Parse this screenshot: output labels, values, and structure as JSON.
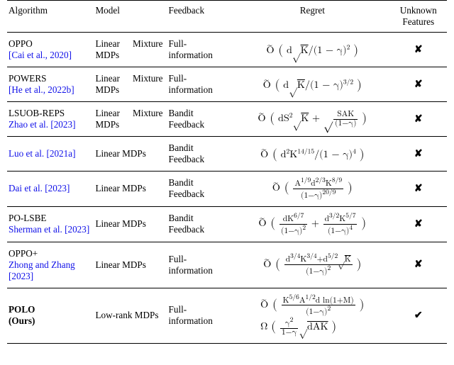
{
  "headers": {
    "algo": "Algorithm",
    "model": "Model",
    "feedback": "Feedback",
    "regret": "Regret",
    "unknown": "Unknown Features"
  },
  "rows": [
    {
      "algo_name": "OPPO",
      "cite": "[Cai et al., 2020]",
      "model": "Linear Mixture MDPs",
      "feedback": "Full-information",
      "regret_html": "<span class='tilde-o'>O</span> <span class='big'>(</span> d<span style='font-size:14px'>√</span><span class='sqrt'>K</span>/(1 − γ)<sup>2</sup> <span class='big'>)</span>",
      "unknown": false
    },
    {
      "algo_name": "POWERS",
      "cite": "[He et al., 2022b]",
      "model": "Linear Mixture MDPs",
      "feedback": "Full-information",
      "regret_html": "<span class='tilde-o'>O</span> <span class='big'>(</span> d<span style='font-size:14px'>√</span><span class='sqrt'>K</span>/(1 − γ)<sup>3/2</sup> <span class='big'>)</span>",
      "unknown": false
    },
    {
      "algo_name": "LSUOB-REPS",
      "cite": "Zhao et al. [2023]",
      "model": "Linear Mixture MDPs",
      "feedback": "Bandit Feedback",
      "regret_html": "<span class='tilde-o'>O</span> <span class='big'>(</span> dS<sup>2</sup><span style='font-size:14px'>√</span><span class='sqrt'>K</span> + <span style='font-size:16px;position:relative;top:1px'>√</span><span class='sqrt'><span class='frac'><span class='num'>SAK</span><span class='den'>(1−γ)</span></span></span> <span class='big'>)</span>",
      "unknown": false
    },
    {
      "algo_name": "",
      "cite": "Luo et al. [2021a]",
      "model": "Linear MDPs",
      "feedback": "Bandit Feedback",
      "regret_html": "<span class='tilde-o'>O</span> <span class='big'>(</span> d<sup>2</sup>K<sup>14/15</sup>/(1 − γ)<sup>4</sup> <span class='big'>)</span>",
      "unknown": false
    },
    {
      "algo_name": "",
      "cite": "Dai et al. [2023]",
      "model": "Linear MDPs",
      "feedback": "Bandit Feedback",
      "regret_html": "<span class='tilde-o'>O</span> <span class='big'>(</span> <span class='frac'><span class='num'>A<sup>1/9</sup>d<sup>2/3</sup>K<sup>8/9</sup></span><span class='den'>(1−γ)<sup>20/9</sup></span></span> <span class='big'>)</span>",
      "unknown": false
    },
    {
      "algo_name": "PO-LSBE",
      "cite": "Sherman et al. [2023]",
      "model": "Linear MDPs",
      "feedback": "Bandit Feedback",
      "regret_html": "<span class='tilde-o'>O</span> <span class='big'>(</span> <span class='frac'><span class='num'>dK<sup>6/7</sup></span><span class='den'>(1−γ)<sup>2</sup></span></span> + <span class='frac'><span class='num'>d<sup>3/2</sup>K<sup>5/7</sup></span><span class='den'>(1−γ)<sup>4</sup></span></span> <span class='big'>)</span>",
      "unknown": false
    },
    {
      "algo_name": "OPPO+",
      "cite": "Zhong and Zhang [2023]",
      "model": "Linear MDPs",
      "feedback": "Full-information",
      "regret_html": "<span class='tilde-o'>O</span> <span class='big'>(</span> <span class='frac'><span class='num'>d<sup>3/4</sup>K<sup>3/4</sup>+d<sup>5/2</sup>√<span class='sqrt'>K</span></span><span class='den'>(1−γ)<sup>2</sup></span></span> <span class='big'>)</span>",
      "unknown": false
    },
    {
      "algo_name": "POLO",
      "ours_label": "(Ours)",
      "cite": "",
      "model": "Low-rank MDPs",
      "feedback": "Full-information",
      "regret_html": "<span class='stack'><span class='line'><span class='tilde-o'>O</span> <span class='big'>(</span> <span class='frac'><span class='num'>K<sup>5/6</sup>A<sup>1/2</sup>d ln(1+M)</span><span class='den'>(1−γ)<sup>2</sup></span></span> <span class='big'>)</span></span><span class='line'>Ω <span class='big'>(</span> <span class='frac'><span class='num'>γ<sup>2</sup></span><span class='den'>1−γ</span></span><span style='font-size:14px'>√</span><span class='sqrt'>dAK</span> <span class='big'>)</span></span></span>",
      "unknown": true
    }
  ]
}
